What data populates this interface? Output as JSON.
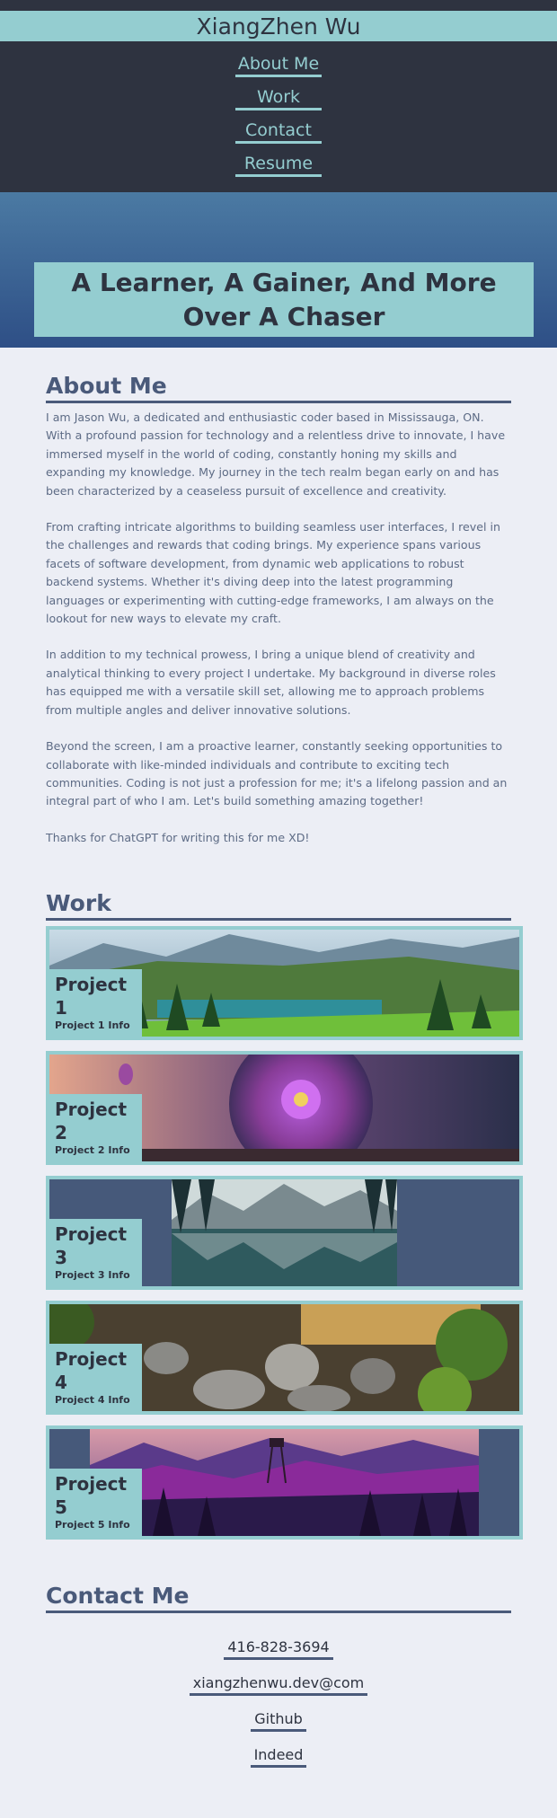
{
  "header": {
    "brand": "XiangZhen Wu",
    "nav": [
      "About Me",
      "Work",
      "Contact",
      "Resume"
    ]
  },
  "hero": {
    "title": "A Learner, A Gainer, And More Over A Chaser"
  },
  "about": {
    "heading": "About Me",
    "paragraphs": [
      "I am Jason Wu, a dedicated and enthusiastic coder based in Mississauga, ON. With a profound passion for technology and a relentless drive to innovate, I have immersed myself in the world of coding, constantly honing my skills and expanding my knowledge. My journey in the tech realm began early on and has been characterized by a ceaseless pursuit of excellence and creativity.",
      "From crafting intricate algorithms to building seamless user interfaces, I revel in the challenges and rewards that coding brings. My experience spans various facets of software development, from dynamic web applications to robust backend systems. Whether it's diving deep into the latest programming languages or experimenting with cutting-edge frameworks, I am always on the lookout for new ways to elevate my craft.",
      "In addition to my technical prowess, I bring a unique blend of creativity and analytical thinking to every project I undertake. My background in diverse roles has equipped me with a versatile skill set, allowing me to approach problems from multiple angles and deliver innovative solutions.",
      "Beyond the screen, I am a proactive learner, constantly seeking opportunities to collaborate with like-minded individuals and contribute to exciting tech communities. Coding is not just a profession for me; it's a lifelong passion and an integral part of who I am. Let's build something amazing together!",
      "Thanks for ChatGPT for writing this for me XD!"
    ]
  },
  "work": {
    "heading": "Work",
    "projects": [
      {
        "title": "Project 1",
        "info": "Project 1 Info"
      },
      {
        "title": "Project 2",
        "info": "Project 2 Info"
      },
      {
        "title": "Project 3",
        "info": "Project 3 Info"
      },
      {
        "title": "Project 4",
        "info": "Project 4 Info"
      },
      {
        "title": "Project 5",
        "info": "Project 5 Info"
      }
    ]
  },
  "contact": {
    "heading": "Contact Me",
    "phone": "416-828-3694",
    "email": "xiangzhenwu.dev@com",
    "github": "Github",
    "indeed": "Indeed"
  },
  "colors": {
    "accent": "#94cdd0",
    "dark": "#2e3340",
    "text": "#4a5a7a",
    "background": "#eceef5"
  }
}
